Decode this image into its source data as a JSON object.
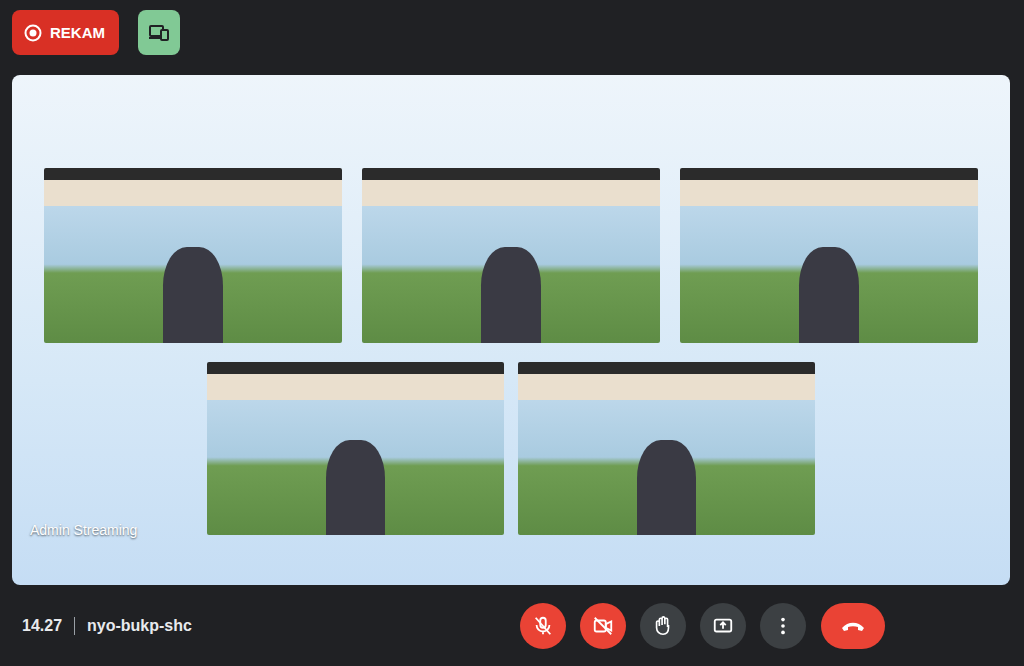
{
  "recording": {
    "label": "REKAM",
    "on": true
  },
  "stage": {
    "participant": "Admin Streaming"
  },
  "meeting": {
    "time": "14.27",
    "code": "nyo-bukp-shc"
  },
  "controls": {
    "microphone_on": false,
    "camera_on": false
  }
}
